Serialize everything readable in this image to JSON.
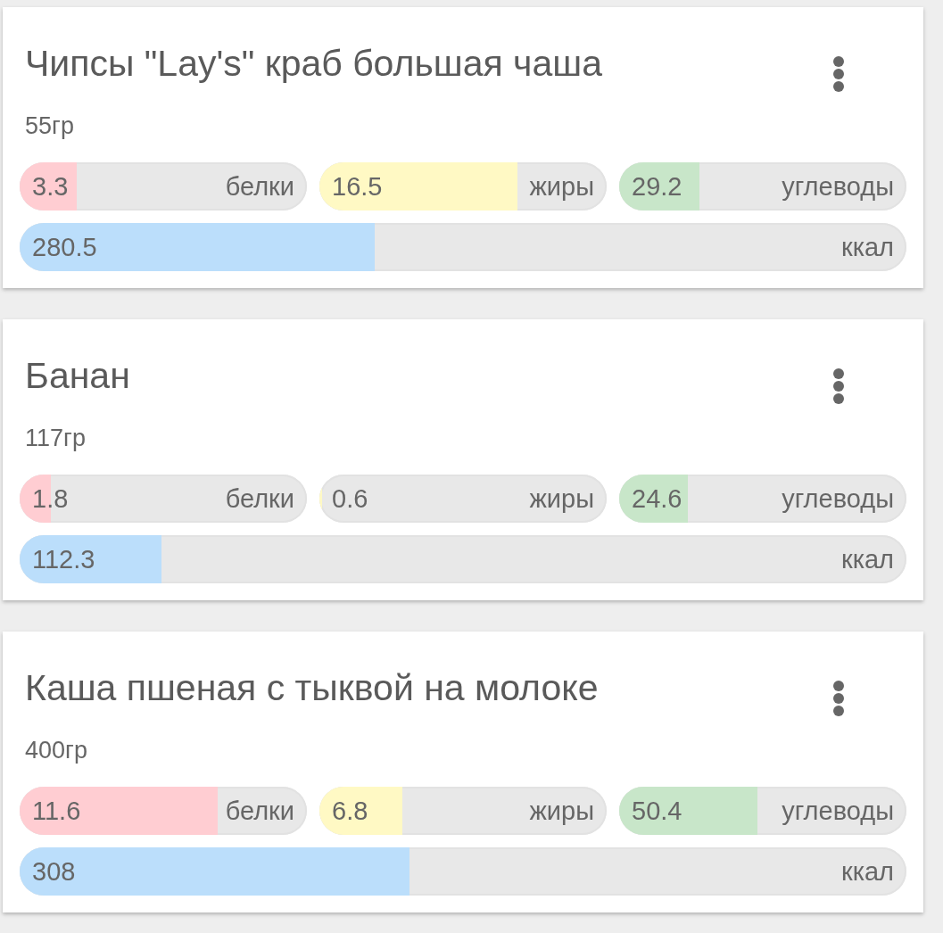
{
  "items": [
    {
      "title": "Чипсы \"Lay's\" краб большая чаша",
      "weight": "55гр",
      "macros": [
        {
          "amount": "3.3",
          "nutrient": "белки",
          "level": 0.2,
          "color": "#ffcdd2"
        },
        {
          "amount": "16.5",
          "nutrient": "жиры",
          "level": 0.69,
          "color": "#fff9c4"
        },
        {
          "amount": "29.2",
          "nutrient": "углеводы",
          "level": 0.28,
          "color": "#c8e6c9"
        }
      ],
      "energy": {
        "amount": "280.5",
        "unit": "ккал",
        "level": 0.4,
        "color": "#bbdefb"
      }
    },
    {
      "title": "Банан",
      "weight": "117гр",
      "macros": [
        {
          "amount": "1.8",
          "nutrient": "белки",
          "level": 0.11,
          "color": "#ffcdd2"
        },
        {
          "amount": "0.6",
          "nutrient": "жиры",
          "level": 0.01,
          "color": "#fff9c4"
        },
        {
          "amount": "24.6",
          "nutrient": "углеводы",
          "level": 0.24,
          "color": "#c8e6c9"
        }
      ],
      "energy": {
        "amount": "112.3",
        "unit": "ккал",
        "level": 0.16,
        "color": "#bbdefb"
      }
    },
    {
      "title": "Каша пшеная с тыквой на молоке",
      "weight": "400гр",
      "macros": [
        {
          "amount": "11.6",
          "nutrient": "белки",
          "level": 0.69,
          "color": "#ffcdd2"
        },
        {
          "amount": "6.8",
          "nutrient": "жиры",
          "level": 0.29,
          "color": "#fff9c4"
        },
        {
          "amount": "50.4",
          "nutrient": "углеводы",
          "level": 0.48,
          "color": "#c8e6c9"
        }
      ],
      "energy": {
        "amount": "308",
        "unit": "ккал",
        "level": 0.44,
        "color": "#bbdefb"
      }
    }
  ]
}
